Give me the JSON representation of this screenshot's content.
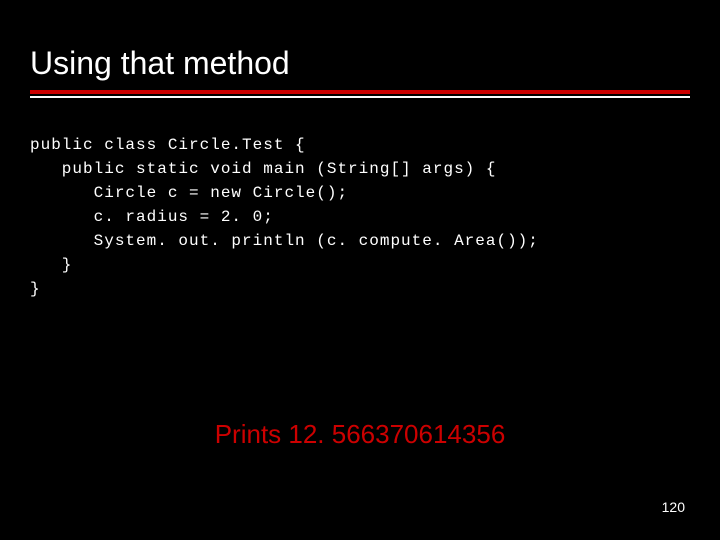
{
  "title": "Using that method",
  "code": {
    "line1": "public class Circle.Test {",
    "line2": "   public static void main (String[] args) {",
    "line3": "      Circle c = new Circle();",
    "line4": "      c. radius = 2. 0;",
    "line5": "      System. out. println (c. compute. Area());",
    "line6": "   }",
    "line7": "}"
  },
  "result": "Prints 12. 566370614356",
  "page_number": "120"
}
